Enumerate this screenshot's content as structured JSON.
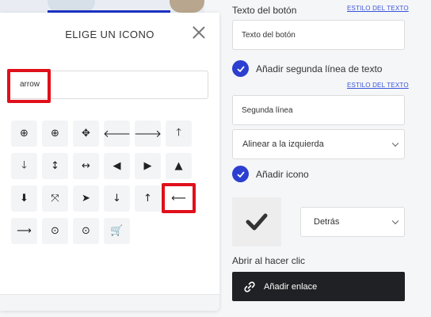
{
  "modal": {
    "title": "ELIGE UN ICONO",
    "search_value": "arrow",
    "icons": [
      {
        "name": "circle-arrow-down-icon",
        "glyph": "⊕"
      },
      {
        "name": "circle-arrow-up-icon",
        "glyph": "⊕"
      },
      {
        "name": "move-arrows-icon",
        "glyph": "✥"
      },
      {
        "name": "arrow-left-icon",
        "glyph": "🡐"
      },
      {
        "name": "arrow-right-icon",
        "glyph": "🡒"
      },
      {
        "name": "arrow-up-icon",
        "glyph": "🡑"
      },
      {
        "name": "arrow-down-icon",
        "glyph": "🡓"
      },
      {
        "name": "arrows-vertical-icon",
        "glyph": "↕"
      },
      {
        "name": "arrows-horizontal-icon",
        "glyph": "↔"
      },
      {
        "name": "circle-chevron-left-icon",
        "glyph": "◀"
      },
      {
        "name": "circle-chevron-right-icon",
        "glyph": "▶"
      },
      {
        "name": "circle-chevron-up-icon",
        "glyph": "▲"
      },
      {
        "name": "circle-arrow-down-solid-icon",
        "glyph": "⬇"
      },
      {
        "name": "expand-arrows-icon",
        "glyph": "⤧"
      },
      {
        "name": "location-arrow-icon",
        "glyph": "➤"
      },
      {
        "name": "long-arrow-down-icon",
        "glyph": "↓"
      },
      {
        "name": "long-arrow-up-icon",
        "glyph": "↑"
      },
      {
        "name": "long-arrow-left-icon",
        "glyph": "⟵"
      },
      {
        "name": "long-arrow-right-icon",
        "glyph": "⟶"
      },
      {
        "name": "circle-arrow-right-icon",
        "glyph": "⊙"
      },
      {
        "name": "circle-arrow-right-alt-icon",
        "glyph": "⊙"
      },
      {
        "name": "cart-arrow-down-icon",
        "glyph": "🛒"
      }
    ]
  },
  "panel": {
    "button_text_label": "Texto del botón",
    "text_style_link": "ESTILO DEL TEXTO",
    "button_text_value": "Texto del botón",
    "second_line_label": "Añadir segunda línea de texto",
    "second_line_style_link": "ESTILO DEL TEXTO",
    "second_line_value": "Segunda línea",
    "align_select": "Alinear a la izquierda",
    "add_icon_label": "Añadir icono",
    "icon_position_select": "Detrás",
    "on_click_label": "Abrir al hacer clic",
    "add_link_button": "Añadir enlace"
  },
  "colors": {
    "accent_blue": "#2c3fd0",
    "highlight_red": "#e0101a",
    "dark_button": "#202124"
  }
}
